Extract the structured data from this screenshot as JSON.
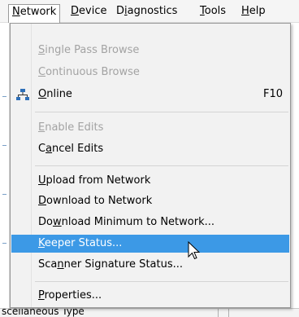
{
  "menubar": {
    "items": [
      {
        "label": "Network",
        "active": true
      },
      {
        "label": "Device"
      },
      {
        "label": "Diagnostics"
      },
      {
        "label": "Tools"
      },
      {
        "label": "Help"
      }
    ]
  },
  "menu": {
    "items": [
      {
        "label": "Single Pass Browse",
        "disabled": true
      },
      {
        "label": "Continuous Browse",
        "disabled": true
      },
      {
        "label": "Online",
        "icon": "network-icon",
        "shortcut": "F10"
      },
      {
        "label": "Enable Edits",
        "disabled": true
      },
      {
        "label": "Cancel Edits"
      },
      {
        "label": "Upload from Network"
      },
      {
        "label": "Download to Network"
      },
      {
        "label": "Download Minimum to Network..."
      },
      {
        "label": "Keeper Status...",
        "highlighted": true
      },
      {
        "label": "Scanner Signature Status..."
      },
      {
        "label": "Properties..."
      }
    ]
  },
  "background": {
    "bottom_text": "scellaneous Type"
  },
  "colors": {
    "highlight": "#3c99e6",
    "disabled_text": "#a3a3a3",
    "menu_bg": "#f2f2f2"
  },
  "cursor": "arrow-pointer-icon"
}
